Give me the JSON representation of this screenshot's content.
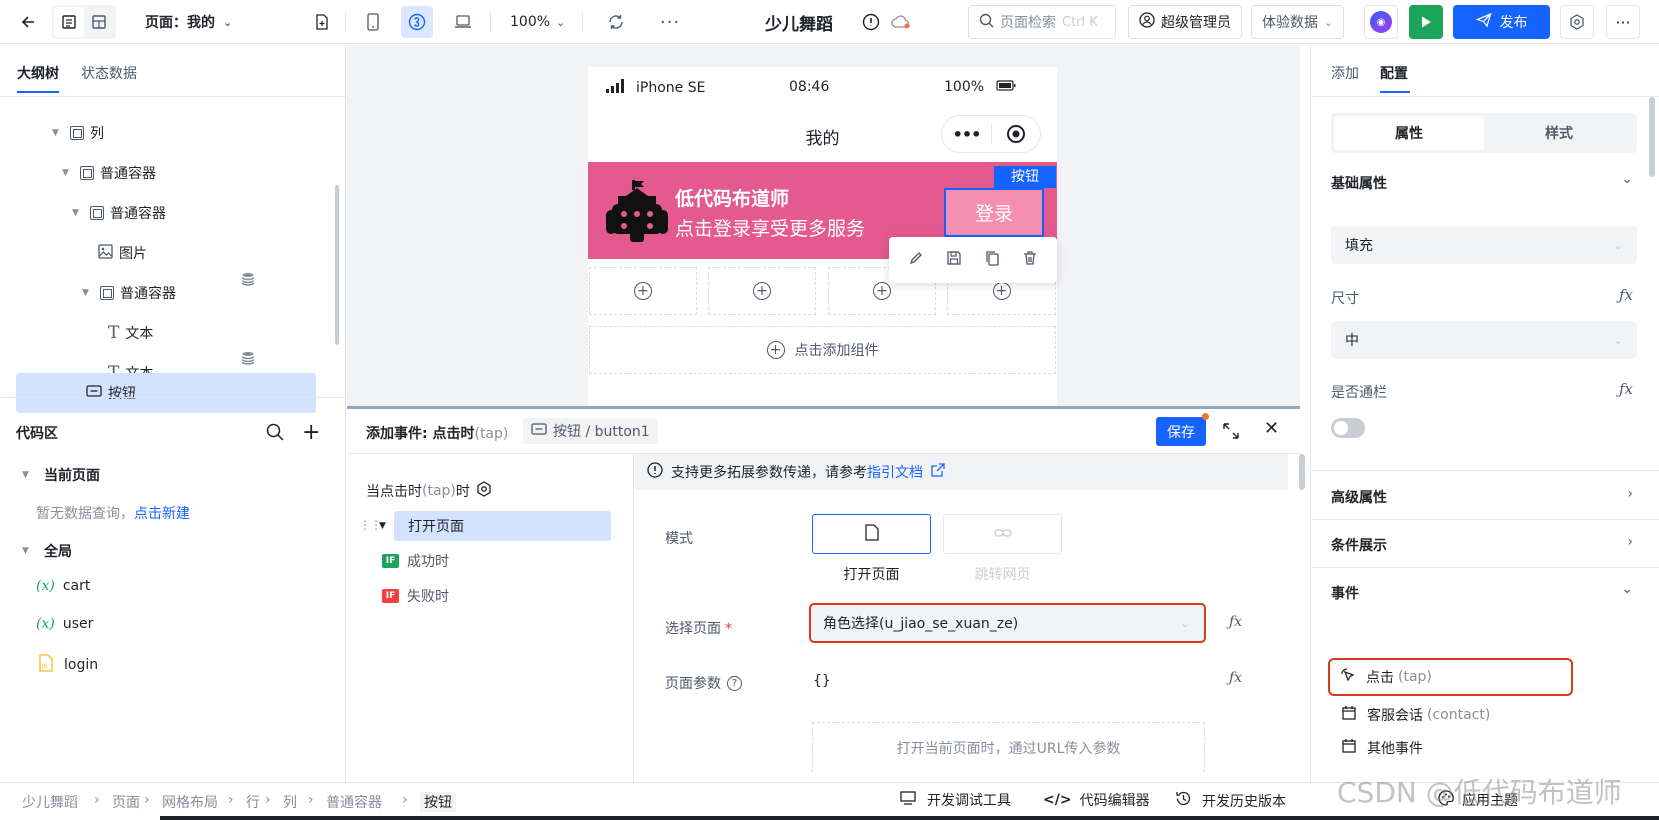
{
  "topbar": {
    "page_label": "页面：我的",
    "zoom": "100%",
    "app_name": "少儿舞蹈",
    "search_placeholder": "页面检索",
    "search_shortcut": "Ctrl K",
    "admin_label": "超级管理员",
    "env_label": "体验数据",
    "publish_label": "发布"
  },
  "left": {
    "tabs": [
      "大纲树",
      "状态数据"
    ],
    "tree": [
      {
        "label": "列",
        "depth": 0
      },
      {
        "label": "普通容器",
        "depth": 1
      },
      {
        "label": "普通容器",
        "depth": 2
      },
      {
        "label": "图片",
        "depth": 3
      },
      {
        "label": "普通容器",
        "depth": 3
      },
      {
        "label": "文本",
        "depth": 4
      },
      {
        "label": "文本",
        "depth": 4
      },
      {
        "label": "按钮",
        "depth": 3
      }
    ],
    "code_title": "代码区",
    "current_page": "当前页面",
    "no_query": "暂无数据查询，",
    "new_link": "点击新建",
    "global": "全局",
    "vars": [
      "cart",
      "user"
    ],
    "file": "login"
  },
  "phone": {
    "device": "iPhone SE",
    "time": "08:46",
    "battery": "100%",
    "title": "我的",
    "banner_title": "低代码布道师",
    "banner_sub": "点击登录享受更多服务",
    "button_tag": "按钮",
    "login_label": "登录",
    "add_component": "点击添加组件"
  },
  "event": {
    "title": "添加事件: 点击时",
    "title_tap": "(tap)",
    "crumb": "按钮 / button1",
    "save": "保存",
    "when_prefix": "当点击时",
    "when_tap": "(tap)",
    "when_suffix": "时",
    "action": "打开页面",
    "success": "成功时",
    "fail": "失败时",
    "notice": "支持更多拓展参数传递，请参考",
    "notice_link": "指引文档",
    "mode_label": "模式",
    "mode_open": "打开页面",
    "mode_jump": "跳转网页",
    "page_label": "选择页面",
    "page_value": "角色选择(u_jiao_se_xuan_ze)",
    "params_label": "页面参数",
    "params_value": "{}",
    "params_hint": "打开当前页面时，通过URL传入参数"
  },
  "right": {
    "tabs": [
      "添加",
      "配置"
    ],
    "sub_tabs": [
      "属性",
      "样式"
    ],
    "basic": "基础属性",
    "fill_value": "填充",
    "size_label": "尺寸",
    "size_value": "中",
    "block_label": "是否通栏",
    "advanced": "高级属性",
    "condition": "条件展示",
    "events": "事件",
    "ev_tap": "点击",
    "ev_tap_code": "(tap)",
    "ev_contact": "客服会话",
    "ev_contact_code": "(contact)",
    "ev_other": "其他事件"
  },
  "status": {
    "breadcrumbs": [
      "少儿舞蹈",
      "页面",
      "网格布局",
      "行",
      "列",
      "普通容器",
      "按钮"
    ],
    "debug": "开发调试工具",
    "code_editor": "代码编辑器",
    "history": "开发历史版本",
    "theme": "应用主题",
    "watermark": "CSDN @低代码布道师"
  },
  "colors": {
    "primary": "#1664ff",
    "banner": "#e45a8f",
    "login": "#f48fb1",
    "highlight": "#d93b1a",
    "run": "#1aa55b"
  }
}
